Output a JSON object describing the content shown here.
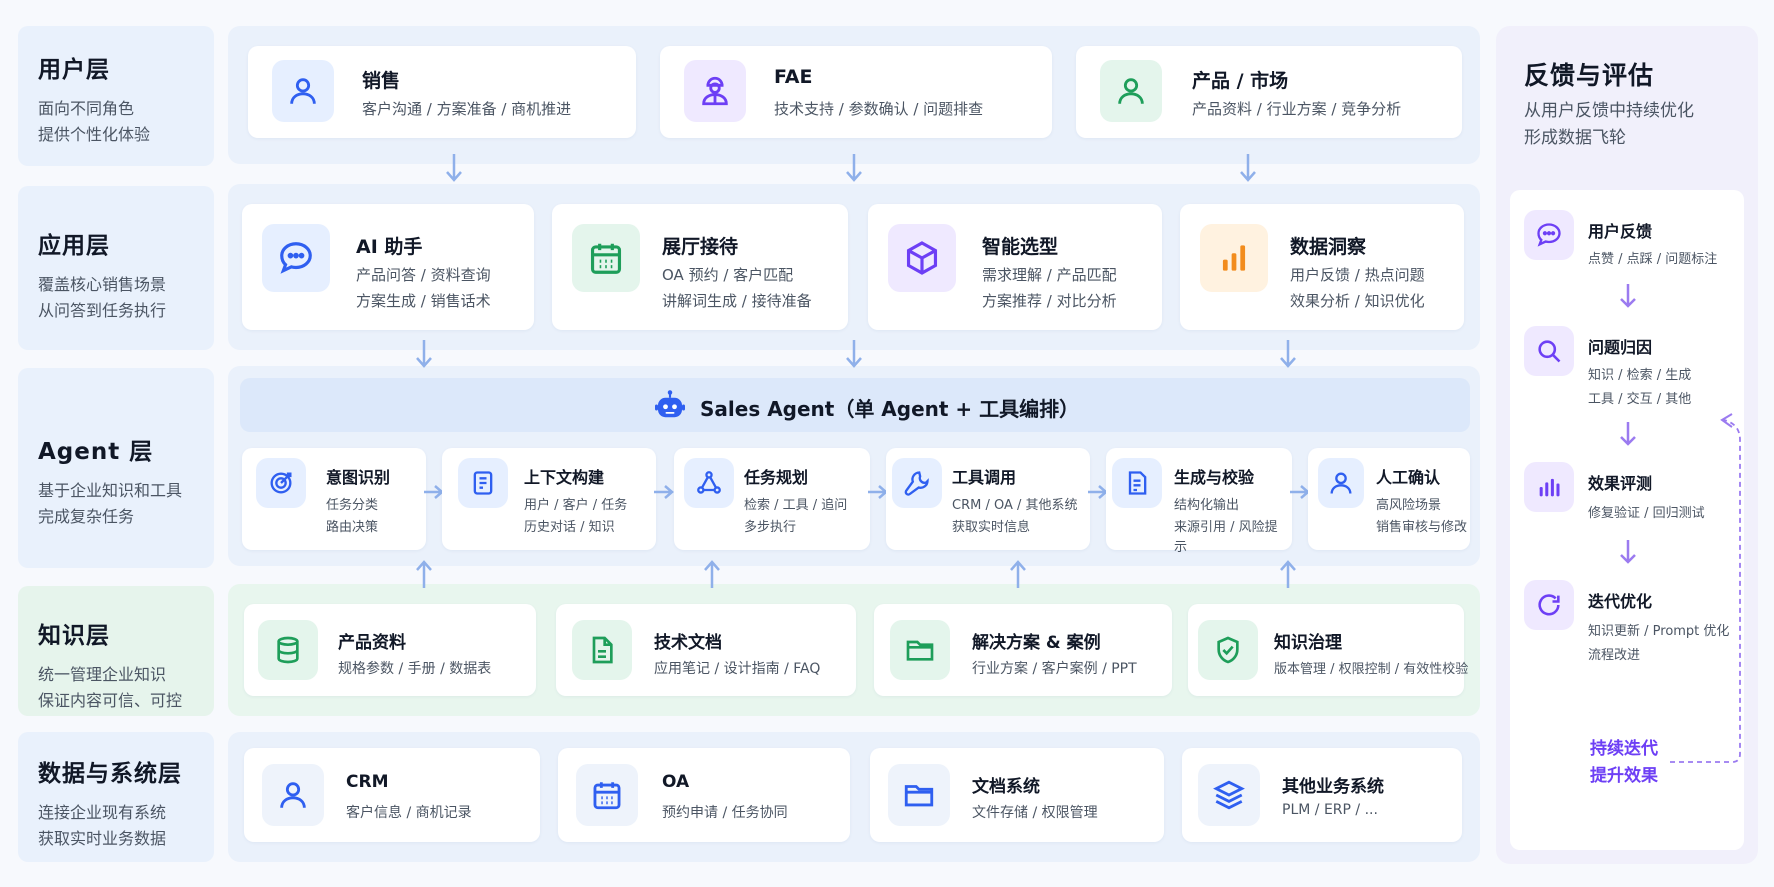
{
  "colors": {
    "accent_blue": "#2f5ff0",
    "accent_purple": "#6d3ff5",
    "accent_green": "#1e9e5a",
    "accent_orange": "#f28c1d",
    "arrow": "#8fb0ea"
  },
  "layers": [
    {
      "title": "用户层",
      "desc1": "面向不同角色",
      "desc2": "提供个性化体验"
    },
    {
      "title": "应用层",
      "desc1": "覆盖核心销售场景",
      "desc2": "从问答到任务执行"
    },
    {
      "title": "Agent 层",
      "desc1": "基于企业知识和工具",
      "desc2": "完成复杂任务"
    },
    {
      "title": "知识层",
      "desc1": "统一管理企业知识",
      "desc2": "保证内容可信、可控"
    },
    {
      "title": "数据与系统层",
      "desc1": "连接企业现有系统",
      "desc2": "获取实时业务数据"
    }
  ],
  "users": [
    {
      "title": "销售",
      "line": "客户沟通 / 方案准备 / 商机推进",
      "icon": "user-icon"
    },
    {
      "title": "FAE",
      "line": "技术支持 / 参数确认 / 问题排查",
      "icon": "engineer-icon"
    },
    {
      "title": "产品 / 市场",
      "line": "产品资料 / 行业方案 / 竞争分析",
      "icon": "user-icon"
    }
  ],
  "apps": [
    {
      "title": "AI 助手",
      "line1": "产品问答 / 资料查询",
      "line2": "方案生成 / 销售话术",
      "icon": "chat-icon"
    },
    {
      "title": "展厅接待",
      "line1": "OA 预约 / 客户匹配",
      "line2": "讲解词生成 / 接待准备",
      "icon": "calendar-icon"
    },
    {
      "title": "智能选型",
      "line1": "需求理解 / 产品匹配",
      "line2": "方案推荐 / 对比分析",
      "icon": "cube-icon"
    },
    {
      "title": "数据洞察",
      "line1": "用户反馈 / 热点问题",
      "line2": "效果分析 / 知识优化",
      "icon": "bar-chart-icon"
    }
  ],
  "agent": {
    "title": "Sales Agent（单 Agent + 工具编排）",
    "steps": [
      {
        "title": "意图识别",
        "line1": "任务分类",
        "line2": "路由决策",
        "line3": "",
        "icon": "target-icon"
      },
      {
        "title": "上下文构建",
        "line1": "用户 / 客户 / 任务",
        "line2": "历史对话 / 知识",
        "line3": "",
        "icon": "document-icon"
      },
      {
        "title": "任务规划",
        "line1": "检索 / 工具 / 追问",
        "line2": "多步执行",
        "line3": "",
        "icon": "flow-icon"
      },
      {
        "title": "工具调用",
        "line1": "CRM / OA / 其他系统",
        "line2": "获取实时信息",
        "line3": "",
        "icon": "wrench-icon"
      },
      {
        "title": "生成与校验",
        "line1": "结构化输出",
        "line2": "来源引用 / 风险提",
        "line3": "示",
        "icon": "checklist-icon"
      },
      {
        "title": "人工确认",
        "line1": "高风险场景",
        "line2": "销售审核与修改",
        "line3": "",
        "icon": "user-icon"
      }
    ]
  },
  "knowledge": [
    {
      "title": "产品资料",
      "line": "规格参数 / 手册 / 数据表",
      "icon": "database-icon"
    },
    {
      "title": "技术文档",
      "line": "应用笔记 / 设计指南 / FAQ",
      "icon": "file-icon"
    },
    {
      "title": "解决方案 & 案例",
      "line": "行业方案 / 客户案例 / PPT",
      "icon": "folder-icon"
    },
    {
      "title": "知识治理",
      "line": "版本管理 / 权限控制 / 有效性校验",
      "icon": "shield-check-icon"
    }
  ],
  "systems": [
    {
      "title": "CRM",
      "line": "客户信息 / 商机记录",
      "icon": "user-icon"
    },
    {
      "title": "OA",
      "line": "预约申请 / 任务协同",
      "icon": "calendar-icon"
    },
    {
      "title": "文档系统",
      "line": "文件存储 / 权限管理",
      "icon": "folder-icon"
    },
    {
      "title": "其他业务系统",
      "line": "PLM / ERP / ...",
      "icon": "layers-icon"
    }
  ],
  "feedback": {
    "title": "反馈与评估",
    "desc1": "从用户反馈中持续优化",
    "desc2": "形成数据飞轮",
    "steps": [
      {
        "title": "用户反馈",
        "line1": "点赞 / 点踩 / 问题标注",
        "line2": "",
        "icon": "chat-icon"
      },
      {
        "title": "问题归因",
        "line1": "知识 / 检索 / 生成",
        "line2": "工具 / 交互 / 其他",
        "icon": "search-icon"
      },
      {
        "title": "效果评测",
        "line1": "修复验证 / 回归测试",
        "line2": "",
        "icon": "bar-chart-icon"
      },
      {
        "title": "迭代优化",
        "line1": "知识更新 / Prompt 优化",
        "line2": "流程改进",
        "icon": "refresh-icon"
      }
    ],
    "loop1": "持续迭代",
    "loop2": "提升效果"
  }
}
